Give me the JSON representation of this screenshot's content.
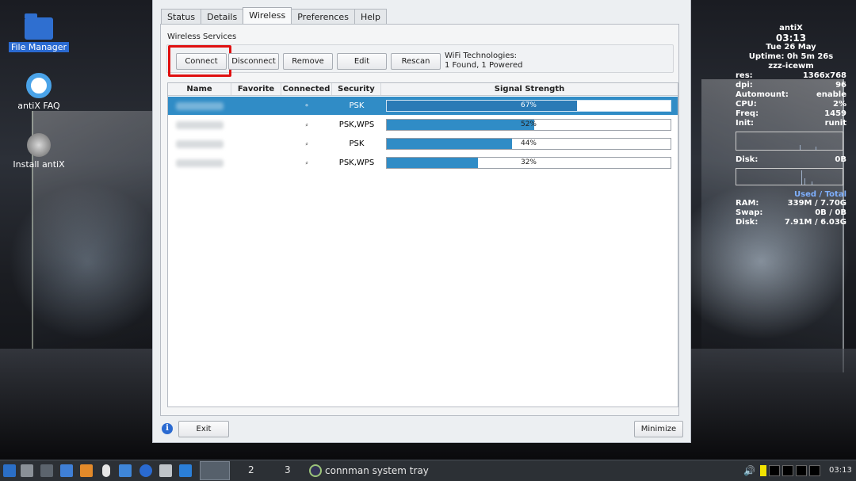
{
  "desktop": {
    "icons": [
      {
        "label": "File Manager",
        "icon": "folder-icon"
      },
      {
        "label": "antiX FAQ",
        "icon": "lifebuoy-icon"
      },
      {
        "label": "Install antiX",
        "icon": "installer-icon"
      }
    ]
  },
  "conky": {
    "host": "antiX",
    "time": "03:13",
    "date": "Tue 26 May",
    "uptime": "Uptime: 0h 5m 26s",
    "wm": "zzz-icewm",
    "rows": [
      {
        "label": "res:",
        "value": "1366x768"
      },
      {
        "label": "dpi:",
        "value": "96"
      },
      {
        "label": "Automount:",
        "value": "enable"
      },
      {
        "label": "CPU:",
        "value": "2%"
      },
      {
        "label": "Freq:",
        "value": "1459"
      },
      {
        "label": "Init:",
        "value": "runit"
      }
    ],
    "disk_label": "Disk:",
    "disk_value": "0B",
    "used_total": "Used / Total",
    "mem_rows": [
      {
        "label": "RAM:",
        "value": "339M / 7.70G"
      },
      {
        "label": "Swap:",
        "value": "0B / 0B"
      },
      {
        "label": "Disk:",
        "value": "7.91M / 6.03G"
      }
    ]
  },
  "window": {
    "tabs": [
      "Status",
      "Details",
      "Wireless",
      "Preferences",
      "Help"
    ],
    "active_tab": "Wireless",
    "section_label": "Wireless Services",
    "buttons": {
      "connect": "Connect",
      "disconnect": "Disconnect",
      "remove": "Remove",
      "edit": "Edit",
      "rescan": "Rescan"
    },
    "wifi_tech_line1": "WiFi Technologies:",
    "wifi_tech_line2": "1 Found, 1 Powered",
    "columns": [
      "Name",
      "Favorite",
      "Connected",
      "Security",
      "Signal Strength"
    ],
    "rows": [
      {
        "security": "PSK",
        "signal": 67,
        "signal_label": "67%",
        "selected": true
      },
      {
        "security": "PSK,WPS",
        "signal": 52,
        "signal_label": "52%",
        "selected": false
      },
      {
        "security": "PSK",
        "signal": 44,
        "signal_label": "44%",
        "selected": false
      },
      {
        "security": "PSK,WPS",
        "signal": 32,
        "signal_label": "32%",
        "selected": false
      }
    ],
    "info_icon": "i",
    "exit_label": "Exit",
    "minimize_label": "Minimize"
  },
  "taskbar": {
    "workspace_2": "2",
    "workspace_3": "3",
    "task_label": "connman system tray",
    "clock": "03:13",
    "colors": {
      "yellow": "#f2e300",
      "bg": "#2c3035"
    }
  }
}
